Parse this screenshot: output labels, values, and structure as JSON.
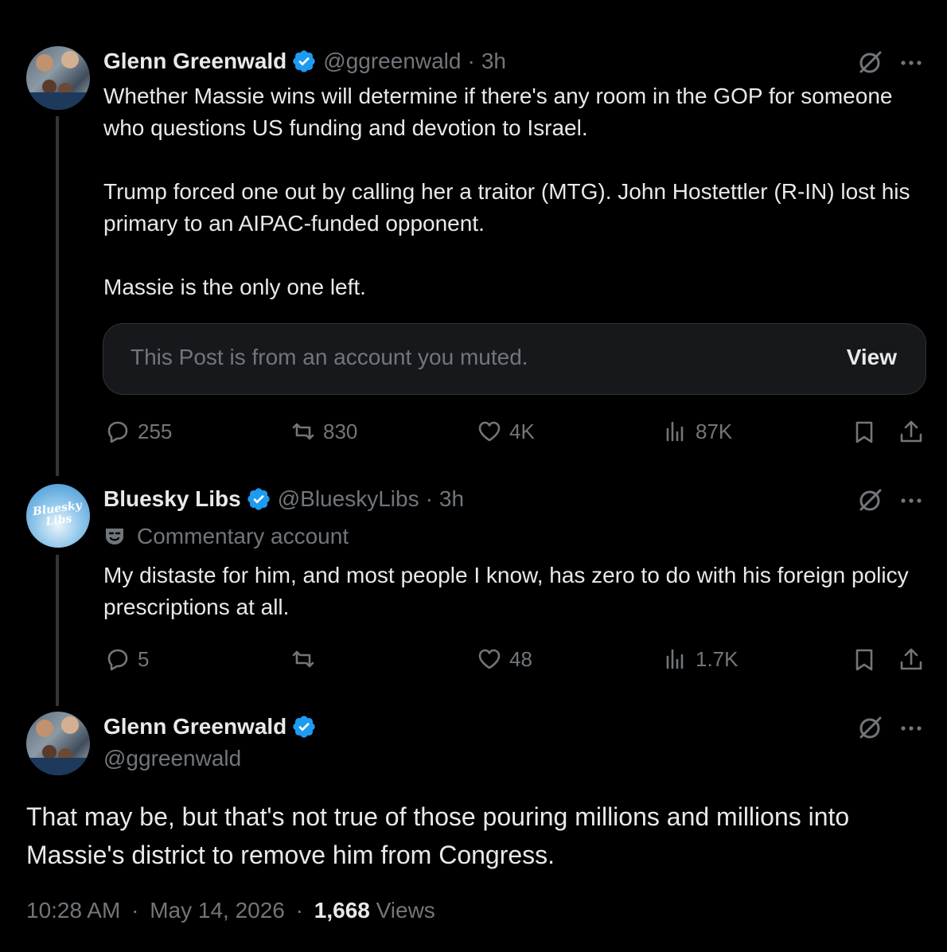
{
  "tweet1": {
    "name": "Glenn Greenwald",
    "handle": "@ggreenwald",
    "separator": "·",
    "time": "3h",
    "text": "Whether Massie wins will determine if there's any room in the GOP for someone who questions US funding and devotion to Israel.\n\nTrump forced one out by calling her a traitor (MTG). John Hostettler (R-IN) lost his primary to an AIPAC-funded opponent.\n\nMassie is the only one left.",
    "muted_notice": "This Post is from an account you muted.",
    "view_label": "View",
    "replies": "255",
    "reposts": "830",
    "likes": "4K",
    "views": "87K"
  },
  "tweet2": {
    "name": "Bluesky Libs",
    "handle": "@BlueskyLibs",
    "separator": "·",
    "time": "3h",
    "avatar_text": "Bluesky Libs",
    "account_tag": "Commentary account",
    "text": "My distaste for him, and most people I know, has zero to do with his foreign policy prescriptions at all.",
    "replies": "5",
    "reposts": "",
    "likes": "48",
    "views": "1.7K"
  },
  "main_tweet": {
    "name": "Glenn Greenwald",
    "handle": "@ggreenwald",
    "text": "That may be, but that's not true of those pouring millions and millions into Massie's district to remove him from Congress.",
    "time": "10:28 AM",
    "separator": "·",
    "date": "May 14, 2026",
    "separator2": "·",
    "view_count": "1,668",
    "views_label": "Views"
  },
  "colors": {
    "background": "#000000",
    "text": "#e7e9ea",
    "secondary": "#71767b",
    "verified": "#1d9bf0"
  }
}
